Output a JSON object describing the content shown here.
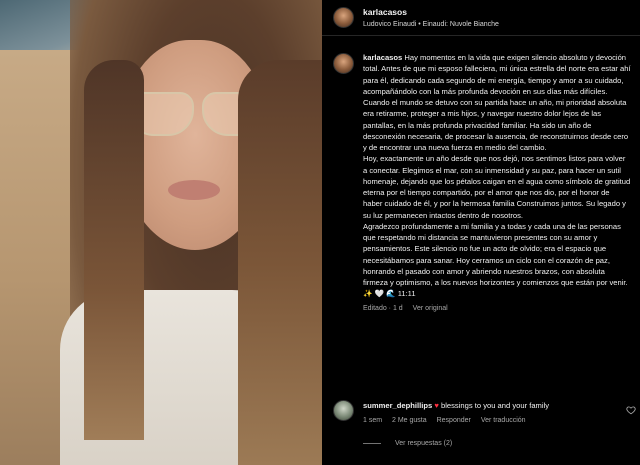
{
  "header": {
    "username": "karlacasos",
    "music": "Ludovico Einaudi • Einaudi: Nuvole Bianche"
  },
  "caption": {
    "username": "karlacasos",
    "text": "Hay momentos en la vida que exigen silencio absoluto y devoción total. Antes de que mi esposo falleciera, mi única estrella del norte era estar ahí para él, dedicando cada segundo de mi energía, tiempo y amor a su cuidado, acompañándolo con la más profunda devoción en sus días más difíciles. Cuando el mundo se detuvo con su partida hace un año, mi prioridad absoluta era retirarme, proteger a mis hijos, y navegar nuestro dolor lejos de las pantallas, en la más profunda privacidad familiar. Ha sido un año de desconexión necesaria, de procesar la ausencia, de reconstruirnos desde cero y de encontrar una nueva fuerza en medio del cambio.\nHoy, exactamente un año desde que nos dejó, nos sentimos listos para volver a conectar. Elegimos el mar, con su inmensidad y su paz, para hacer un sutil homenaje, dejando que los pétalos caigan en el agua como símbolo de gratitud eterna por el tiempo compartido, por el amor que nos dio, por el honor de haber cuidado de él, y por la hermosa familia Construimos juntos. Su legado y su luz permanecen intactos dentro de nosotros.\nAgradezco profundamente a mi familia y a todas y cada una de las personas que respetando mi distancia se mantuvieron presentes con su amor y pensamientos. Este silencio no fue un acto de olvido; era el espacio que necesitábamos para sanar. Hoy cerramos un ciclo con el corazón de paz, honrando el pasado con amor y abriendo nuestros brazos, con absoluta firmeza y optimismo, a los nuevos horizontes y comienzos que están por venir. ✨ 🤍 🌊 11:11",
    "edited": "Editado · 1 d",
    "translate": "Ver original"
  },
  "comment": {
    "username": "summer_dephillips",
    "heart": "♥",
    "text": "blessings to you and your family",
    "time": "1 sem",
    "likes": "2 Me gusta",
    "reply": "Responder",
    "translate": "Ver traducción"
  },
  "replies": {
    "label": "Ver respuestas (2)"
  },
  "colors": {
    "background": "#000000",
    "secondary_text": "#a8a8a8",
    "heart": "#ff3040"
  }
}
